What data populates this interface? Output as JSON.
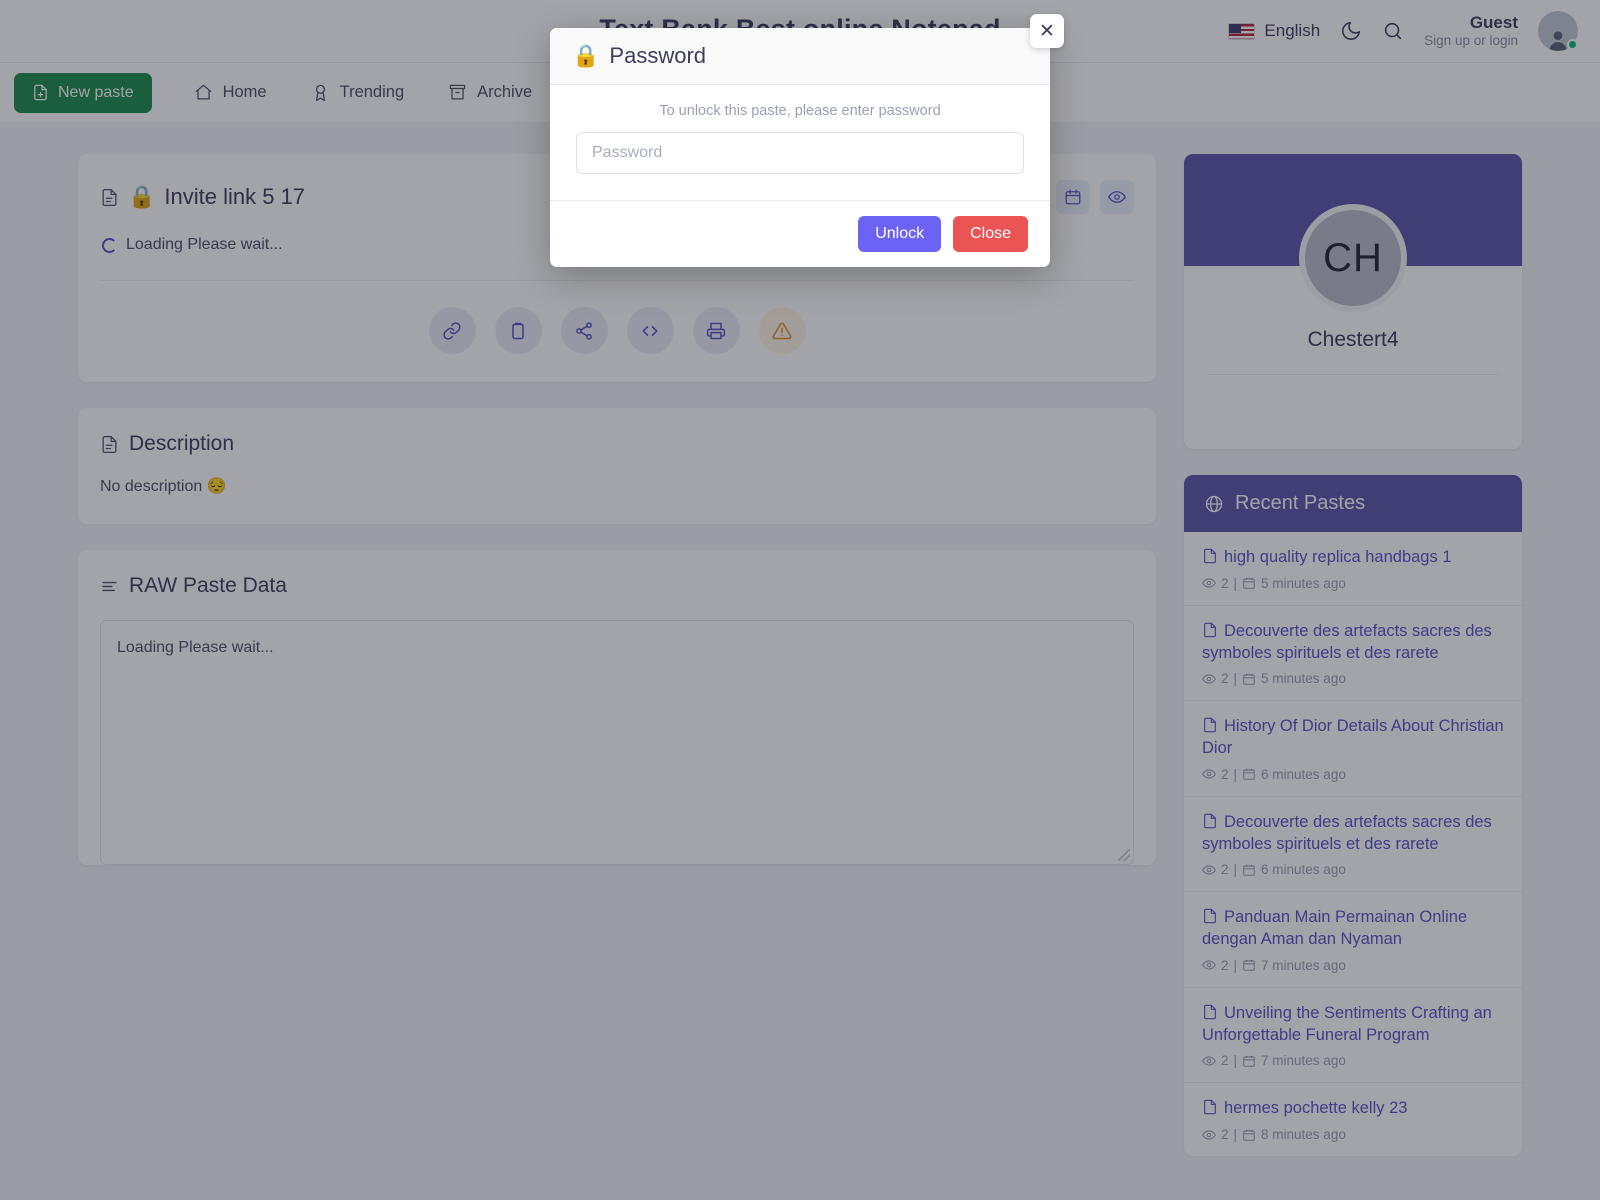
{
  "site": {
    "title": "Text Bank Best online Notepad"
  },
  "topbar": {
    "language": "English",
    "language_flag_icon": "us-flag-icon",
    "theme_toggle_icon": "moon-icon",
    "search_icon": "search-icon",
    "guest_name": "Guest",
    "guest_sub": "Sign up or login",
    "avatar_icon": "user-avatar-icon"
  },
  "nav": {
    "new_paste": "New paste",
    "items": [
      {
        "label": "Home",
        "icon": "home-icon"
      },
      {
        "label": "Trending",
        "icon": "award-icon"
      },
      {
        "label": "Archive",
        "icon": "archive-icon"
      }
    ]
  },
  "paste": {
    "title": "Invite link 5 17",
    "title_doc_icon": "document-icon",
    "title_lock_icon": "lock-icon",
    "loading": "Loading Please wait...",
    "head_actions": [
      {
        "name": "calendar-icon"
      },
      {
        "name": "eye-icon"
      }
    ],
    "actions": [
      {
        "name": "link-icon"
      },
      {
        "name": "clipboard-icon"
      },
      {
        "name": "share-icon"
      },
      {
        "name": "code-icon"
      },
      {
        "name": "print-icon"
      },
      {
        "name": "report-warning-icon"
      }
    ]
  },
  "description": {
    "heading": "Description",
    "icon": "document-icon",
    "body": "No description 😔"
  },
  "raw": {
    "heading": "RAW Paste Data",
    "icon": "align-left-icon",
    "content": "Loading Please wait..."
  },
  "profile": {
    "initials": "CH",
    "username": "Chestert4"
  },
  "recent": {
    "heading": "Recent Pastes",
    "icon": "globe-icon",
    "items": [
      {
        "title": "high quality replica handbags 1",
        "views": "2",
        "time": "5 minutes ago"
      },
      {
        "title": "Decouverte des artefacts sacres des symboles spirituels et des rarete",
        "views": "2",
        "time": "5 minutes ago"
      },
      {
        "title": "History Of Dior Details About Christian Dior",
        "views": "2",
        "time": "6 minutes ago"
      },
      {
        "title": "Decouverte des artefacts sacres des symboles spirituels et des rarete",
        "views": "2",
        "time": "6 minutes ago"
      },
      {
        "title": "Panduan Main Permainan Online dengan Aman dan Nyaman",
        "views": "2",
        "time": "7 minutes ago"
      },
      {
        "title": "Unveiling the Sentiments Crafting an Unforgettable Funeral Program",
        "views": "2",
        "time": "7 minutes ago"
      },
      {
        "title": "hermes pochette kelly 23",
        "views": "2",
        "time": "8 minutes ago"
      }
    ]
  },
  "modal": {
    "title": "Password",
    "title_icon": "lock-icon",
    "close_icon": "close-icon",
    "hint": "To unlock this paste, please enter password",
    "input_placeholder": "Password",
    "input_value": "",
    "unlock_label": "Unlock",
    "close_label": "Close"
  },
  "colors": {
    "accent_purple": "#6c63f5",
    "banner_purple": "#5c55ab",
    "danger_red": "#ea5455",
    "success_green": "#1b8a4b",
    "warning_amber": "#e08a2e"
  }
}
